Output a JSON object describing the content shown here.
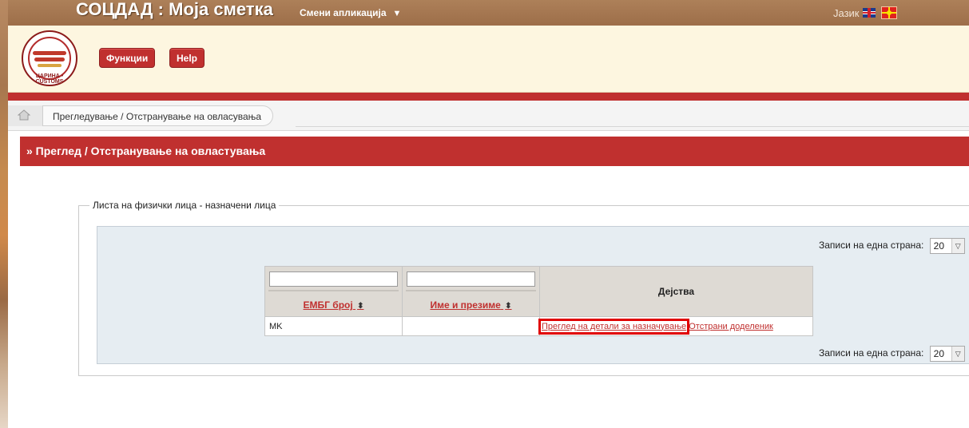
{
  "app": {
    "title": "СОЦДАД : Моја сметка",
    "switch_app_label": "Смени апликација",
    "language_label": "Јазик",
    "logo_text": "ЦАРИНА • CUSTOMS"
  },
  "header": {
    "functions_label": "Функции",
    "help_label": "Help"
  },
  "breadcrumb": {
    "current": "Прегледување / Отстранување на овласувања"
  },
  "section": {
    "title": "» Преглед / Отстранување на овластувања"
  },
  "list": {
    "legend": "Листа на физички лица - назначени лица",
    "per_page_label": "Записи на една страна:",
    "per_page_value": "20",
    "columns": {
      "embg": "ЕМБГ број",
      "name": "Име и презиме",
      "actions": "Дејства"
    },
    "filters": {
      "embg": "",
      "name": ""
    },
    "rows": [
      {
        "embg": "MK",
        "name": "",
        "action_view": "Преглед на детали за назначување",
        "action_remove": "Отстрани доделеник"
      }
    ]
  },
  "colors": {
    "brand_red": "#c0302f",
    "topbar_brown": "#a57650",
    "header_cream": "#fdf6e0",
    "panel_blue": "#e6edf2"
  }
}
